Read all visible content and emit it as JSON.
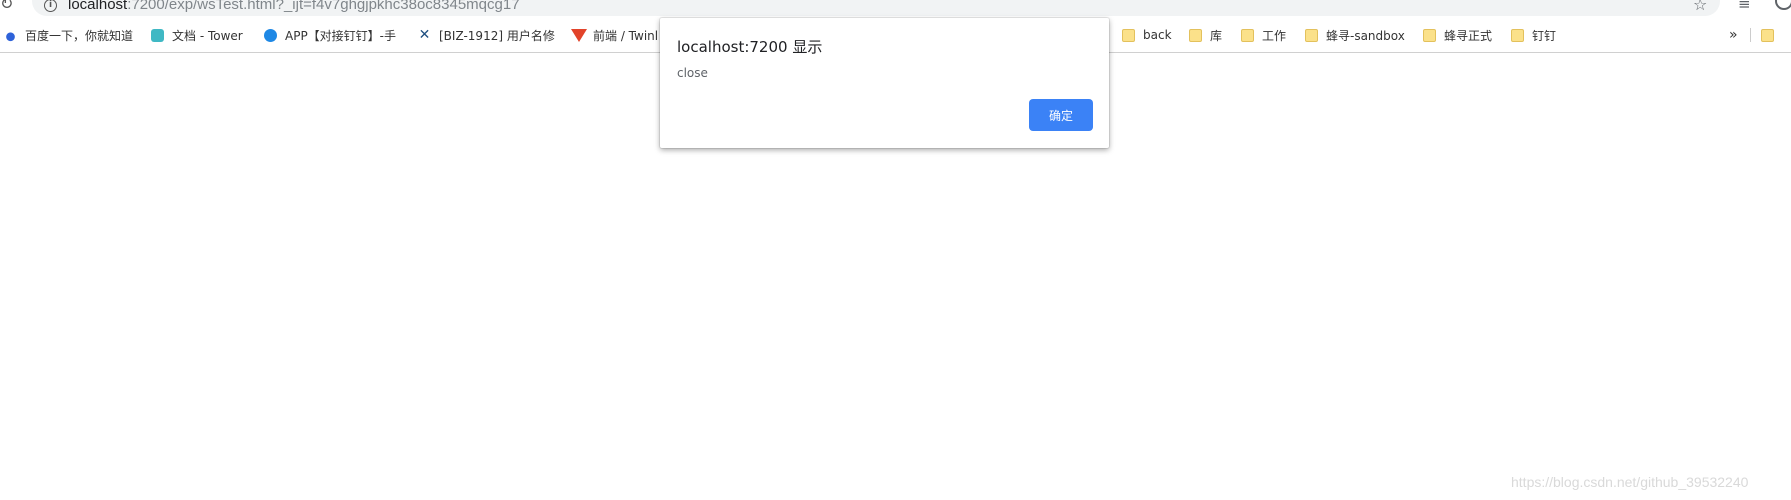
{
  "browser": {
    "url_host": "localhost",
    "url_path": ":7200/exp/wsTest.html?_ijt=f4v7ghgjpkhc38oc8345mqcg17"
  },
  "bookmarks": [
    {
      "label": "百度一下，你就知道",
      "icon": "baidu-icon"
    },
    {
      "label": "文档 - Tower",
      "icon": "tower-icon"
    },
    {
      "label": "APP【对接钉钉】-手",
      "icon": "app-icon"
    },
    {
      "label": "[BIZ-1912] 用户名修",
      "icon": "jira-icon"
    },
    {
      "label": "前端 / Twinl",
      "icon": "gitlab-icon"
    },
    {
      "label": "back",
      "icon": "folder-icon"
    },
    {
      "label": "库",
      "icon": "folder-icon"
    },
    {
      "label": "工作",
      "icon": "folder-icon"
    },
    {
      "label": "蜂寻-sandbox",
      "icon": "folder-icon"
    },
    {
      "label": "蜂寻正式",
      "icon": "folder-icon"
    },
    {
      "label": "钉钉",
      "icon": "folder-icon"
    }
  ],
  "bookmarks_overflow": "»",
  "dialog": {
    "title": "localhost:7200 显示",
    "message": "close",
    "ok_label": "确定"
  },
  "watermark": "https://blog.csdn.net/github_39532240",
  "colors": {
    "accent": "#3b82f6",
    "omnibox": "#f1f3f4"
  }
}
